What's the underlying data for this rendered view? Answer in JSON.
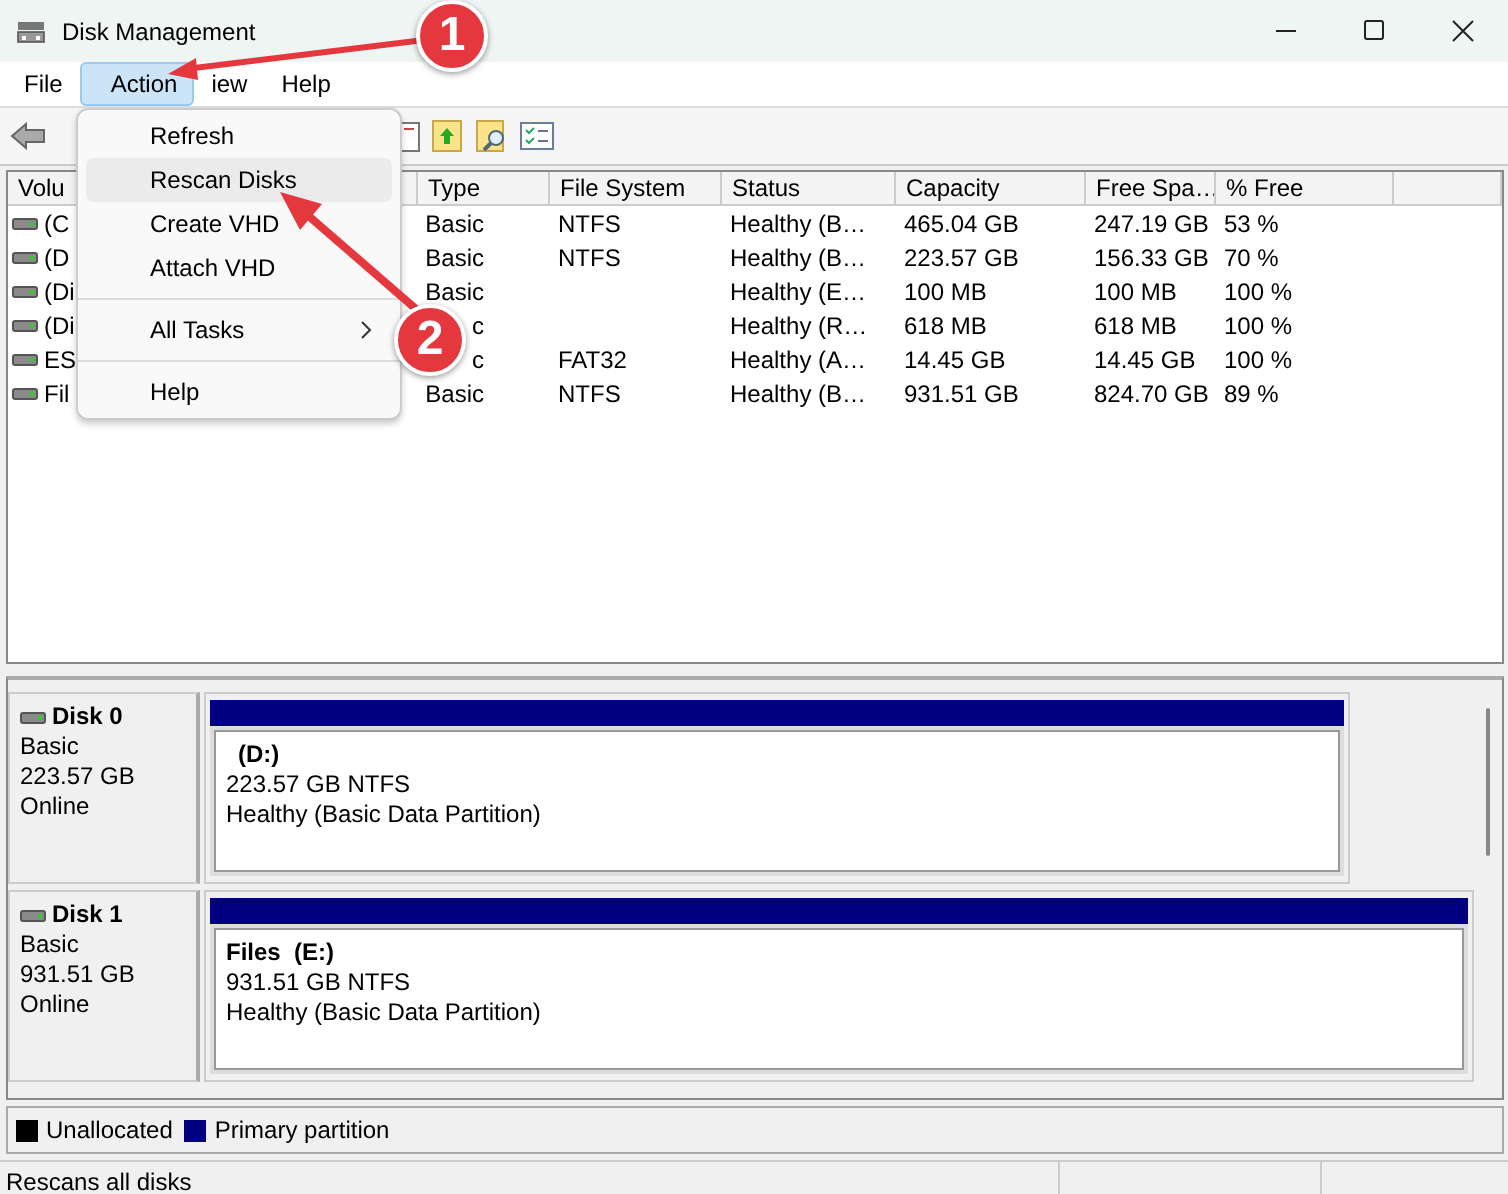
{
  "window": {
    "title": "Disk Management"
  },
  "menu_bar": [
    {
      "label": "File",
      "selected": false
    },
    {
      "label": "Action",
      "selected": true
    },
    {
      "label": "iew",
      "selected": false
    },
    {
      "label": "Help",
      "selected": false
    }
  ],
  "action_menu": [
    {
      "kind": "item",
      "label": "Refresh",
      "selected": false
    },
    {
      "kind": "item",
      "label": "Rescan Disks",
      "selected": true
    },
    {
      "kind": "item",
      "label": "Create VHD",
      "selected": false
    },
    {
      "kind": "item",
      "label": "Attach VHD",
      "selected": false
    },
    {
      "kind": "separator"
    },
    {
      "kind": "submenu",
      "label": "All Tasks",
      "selected": false
    },
    {
      "kind": "separator"
    },
    {
      "kind": "item",
      "label": "Help",
      "selected": false
    }
  ],
  "volume_table": {
    "columns": [
      "Volu",
      "Type",
      "File System",
      "Status",
      "Capacity",
      "Free Spa…",
      "% Free"
    ],
    "rows": [
      [
        "(C",
        "Basic",
        "NTFS",
        "Healthy (B…",
        "465.04 GB",
        "247.19 GB",
        "53 %"
      ],
      [
        "(D",
        "Basic",
        "NTFS",
        "Healthy (B…",
        "223.57 GB",
        "156.33 GB",
        "70 %"
      ],
      [
        "(Di",
        "Basic",
        "",
        "Healthy (E…",
        "100 MB",
        "100 MB",
        "100 %"
      ],
      [
        "(Di",
        "c",
        "",
        "Healthy (R…",
        "618 MB",
        "618 MB",
        "100 %"
      ],
      [
        "ES",
        "c",
        "FAT32",
        "Healthy (A…",
        "14.45 GB",
        "14.45 GB",
        "100 %"
      ],
      [
        "Fil",
        "Basic",
        "NTFS",
        "Healthy (B…",
        "931.51 GB",
        "824.70 GB",
        "89 %"
      ]
    ]
  },
  "disks": [
    {
      "name": "Disk 0",
      "type": "Basic",
      "size": "223.57 GB",
      "status": "Online",
      "partitions": [
        {
          "label": "(D:)",
          "detail": "223.57 GB NTFS",
          "status": "Healthy (Basic Data Partition)"
        }
      ]
    },
    {
      "name": "Disk 1",
      "type": "Basic",
      "size": "931.51 GB",
      "status": "Online",
      "partitions": [
        {
          "label": "Files  (E:)",
          "detail": "931.51 GB NTFS",
          "status": "Healthy (Basic Data Partition)"
        }
      ]
    }
  ],
  "legend": [
    {
      "label": "Unallocated",
      "color": "#000000"
    },
    {
      "label": "Primary partition",
      "color": "#000080"
    }
  ],
  "status_bar": {
    "text": "Rescans all disks"
  },
  "annotations": [
    {
      "number": "1"
    },
    {
      "number": "2"
    }
  ]
}
